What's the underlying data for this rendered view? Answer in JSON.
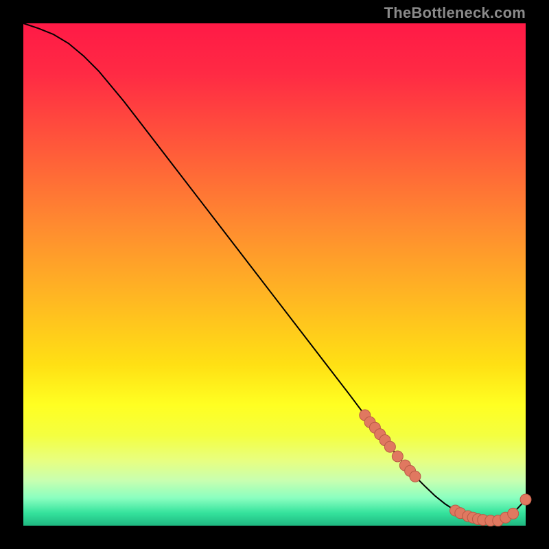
{
  "watermark": "TheBottleneck.com",
  "colors": {
    "gradient_stops": [
      {
        "offset": 0.0,
        "color": "#ff1a46"
      },
      {
        "offset": 0.1,
        "color": "#ff2a44"
      },
      {
        "offset": 0.25,
        "color": "#ff5a3a"
      },
      {
        "offset": 0.4,
        "color": "#ff8a30"
      },
      {
        "offset": 0.55,
        "color": "#ffb822"
      },
      {
        "offset": 0.68,
        "color": "#ffe014"
      },
      {
        "offset": 0.76,
        "color": "#ffff22"
      },
      {
        "offset": 0.82,
        "color": "#f4ff40"
      },
      {
        "offset": 0.87,
        "color": "#e8ff80"
      },
      {
        "offset": 0.91,
        "color": "#c8ffb0"
      },
      {
        "offset": 0.945,
        "color": "#8affc0"
      },
      {
        "offset": 0.975,
        "color": "#34e29c"
      },
      {
        "offset": 1.0,
        "color": "#1fb881"
      }
    ],
    "curve": "#000000",
    "marker_fill": "#e07860",
    "marker_stroke": "#b85a46"
  },
  "chart_data": {
    "type": "line",
    "title": "",
    "xlabel": "",
    "ylabel": "",
    "xlim": [
      0,
      100
    ],
    "ylim": [
      0,
      100
    ],
    "series": [
      {
        "name": "bottleneck-curve",
        "x": [
          0,
          3,
          6,
          9,
          12,
          15,
          20,
          25,
          30,
          35,
          40,
          45,
          50,
          55,
          60,
          65,
          68,
          70,
          72,
          74,
          76,
          78,
          80,
          82,
          84,
          86,
          88,
          90,
          92,
          94,
          96,
          98,
          100
        ],
        "y": [
          100,
          99,
          97.8,
          96,
          93.5,
          90.5,
          84.5,
          78,
          71.5,
          65,
          58.5,
          52,
          45.5,
          39,
          32.5,
          26,
          22,
          19.5,
          17,
          14.5,
          12,
          9.8,
          7.8,
          5.9,
          4.3,
          3.0,
          2.0,
          1.3,
          1.0,
          1.0,
          1.6,
          3.0,
          5.2
        ]
      }
    ],
    "markers": {
      "name": "highlight-points",
      "x": [
        68,
        69,
        70,
        71,
        72,
        73,
        74.5,
        76,
        77,
        78,
        86,
        87,
        88.5,
        89.5,
        90.5,
        91.5,
        93,
        94.5,
        96,
        97.5,
        100
      ],
      "y": [
        22,
        20.6,
        19.5,
        18.2,
        17,
        15.7,
        13.8,
        12,
        10.9,
        9.8,
        3.0,
        2.5,
        1.9,
        1.6,
        1.3,
        1.15,
        1.0,
        1.0,
        1.6,
        2.4,
        5.2
      ]
    }
  }
}
